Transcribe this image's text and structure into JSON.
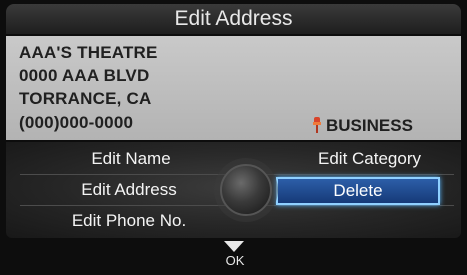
{
  "header": {
    "title": "Edit Address"
  },
  "entry": {
    "name": "AAA'S THEATRE",
    "street": "0000 AAA BLVD",
    "city": "TORRANCE, CA",
    "phone": "(000)000-0000",
    "category": "BUSINESS",
    "category_icon": "pin-icon"
  },
  "menu": {
    "edit_name": "Edit Name",
    "edit_address": "Edit Address",
    "edit_phone": "Edit Phone No.",
    "edit_category": "Edit Category",
    "delete": "Delete",
    "selected": "Delete"
  },
  "footer": {
    "ok_label": "OK",
    "arrow_icon": "down-arrow-icon"
  },
  "colors": {
    "selection": "#1f4a8e",
    "selection_border": "#8fd0ff",
    "info_panel": "#c0c0c0"
  }
}
